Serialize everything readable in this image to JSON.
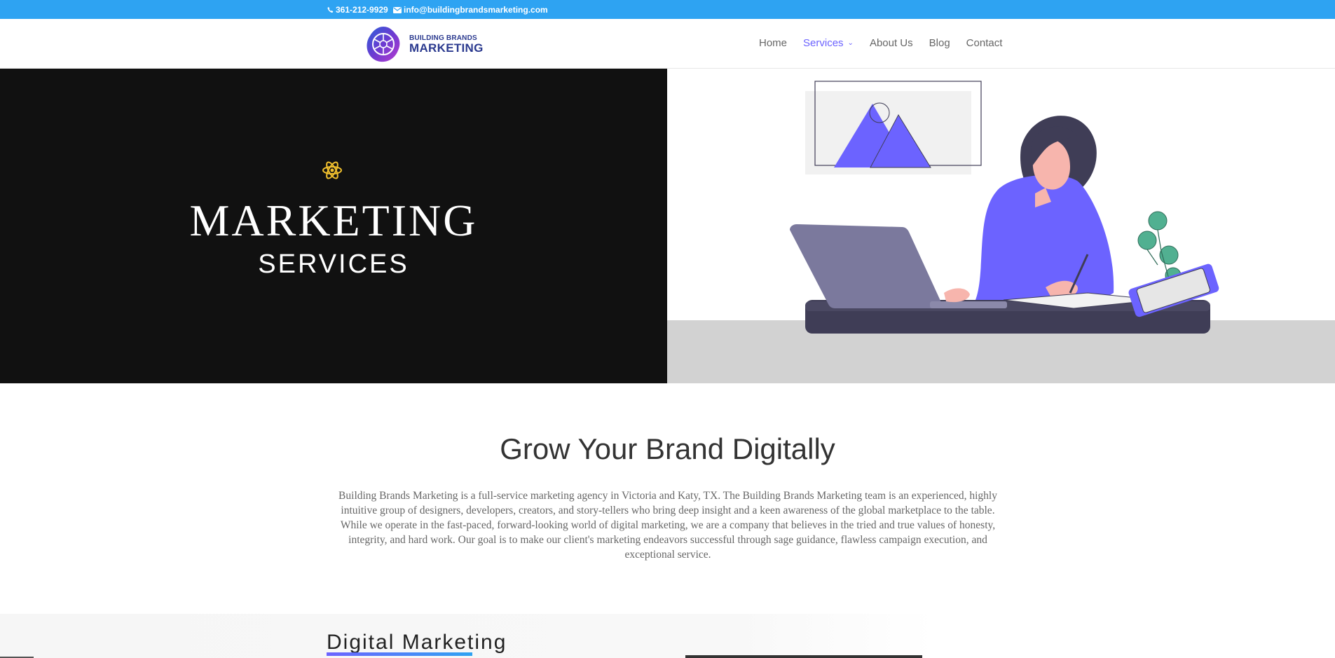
{
  "topbar": {
    "phone": "361-212-9929",
    "email": "info@buildingbrandsmarketing.com",
    "phone_icon": "phone-icon",
    "email_icon": "envelope-icon",
    "bg_color": "#2ea3f2"
  },
  "header": {
    "logo_line1": "BUILDING BRANDS",
    "logo_line2": "MARKETING",
    "nav": [
      {
        "label": "Home"
      },
      {
        "label": "Services",
        "active": true,
        "has_dropdown": true
      },
      {
        "label": "About Us"
      },
      {
        "label": "Blog"
      },
      {
        "label": "Contact"
      }
    ],
    "accent_color": "#6c63ff"
  },
  "hero": {
    "icon": "atom-icon",
    "title": "MARKETING",
    "subtitle": "SERVICES",
    "illustration": "woman-at-laptop-illustration"
  },
  "intro": {
    "title": "Grow Your Brand Digitally",
    "body": "Building Brands Marketing is a full-service marketing agency in Victoria and Katy, TX. The Building Brands Marketing team is an experienced, highly intuitive group of designers, developers, creators, and story-tellers who bring deep insight and a keen awareness of the global marketplace to the table. While we operate in the fast-paced, forward-looking world of digital marketing, we are a company that believes in the tried and true values of honesty, integrity, and hard work. Our goal is to make our client's marketing endeavors successful through sage guidance, flawless campaign execution, and exceptional service."
  },
  "section": {
    "title": "Digital Marketing"
  }
}
